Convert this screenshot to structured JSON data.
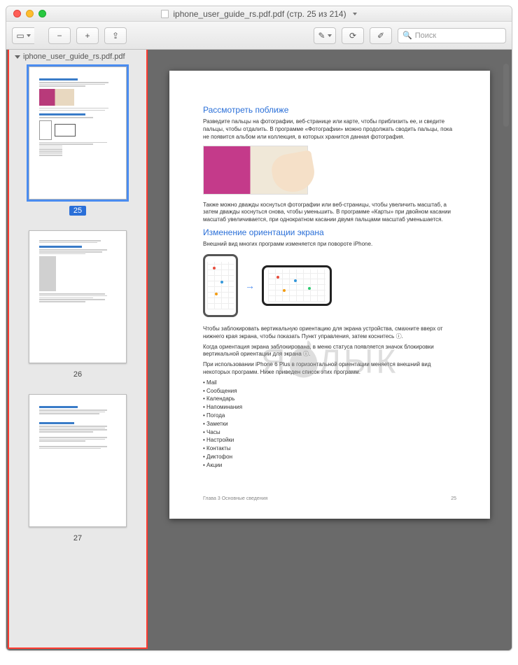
{
  "window": {
    "title": "iphone_user_guide_rs.pdf.pdf (стр. 25 из 214)",
    "doc_title_short": "iphone_user_guide_rs.pdf.pdf"
  },
  "toolbar": {
    "search_placeholder": "Поиск"
  },
  "sidebar": {
    "header": "iphone_user_guide_rs.pdf.pdf",
    "thumbs": [
      {
        "label": "25",
        "active": true
      },
      {
        "label": "26",
        "active": false
      },
      {
        "label": "27",
        "active": false
      }
    ]
  },
  "page": {
    "h1": "Рассмотреть поближе",
    "p1": "Разведите пальцы на фотографии, веб-странице или карте, чтобы приблизить ее, и сведите пальцы, чтобы отдалить. В программе «Фотографии» можно продолжать сводить пальцы, пока не появится альбом или коллекция, в которых хранится данная фотография.",
    "p2": "Также можно дважды коснуться фотографии или веб-страницы, чтобы увеличить масштаб, а затем дважды коснуться снова, чтобы уменьшить. В программе «Карты» при двойном касании масштаб увеличивается, при однократном касании двумя пальцами масштаб уменьшается.",
    "h2": "Изменение ориентации экрана",
    "p3": "Внешний вид многих программ изменяется при повороте iPhone.",
    "p4": "Чтобы заблокировать вертикальную ориентацию для экрана устройства, смахните вверх от нижнего края экрана, чтобы показать Пункт управления, затем коснитесь ⓘ.",
    "p5": "Когда ориентация экрана заблокирована, в меню статуса появляется значок блокировки вертикальной ориентации для экрана ⓘ.",
    "p6": "При использовании iPhone 6 Plus в горизонтальной ориентации меняется внешний вид некоторых программ. Ниже приведен список этих программ.",
    "apps": [
      "Mail",
      "Сообщения",
      "Календарь",
      "Напоминания",
      "Погода",
      "Заметки",
      "Часы",
      "Настройки",
      "Контакты",
      "Диктофон",
      "Акции"
    ],
    "footer_left": "Глава 3    Основные сведения",
    "footer_right": "25"
  },
  "watermark": {
    "left": "Я",
    "right": "ЛЫК"
  }
}
